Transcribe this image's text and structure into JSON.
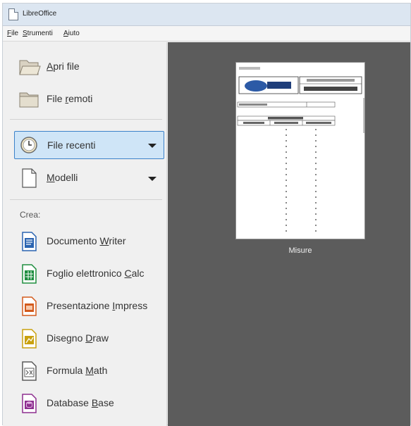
{
  "window": {
    "title": "LibreOffice"
  },
  "menu": {
    "file": {
      "mnemonic": "F",
      "rest": "ile"
    },
    "tools": {
      "mnemonic": "S",
      "rest": "trumenti"
    },
    "help": {
      "mnemonic": "A",
      "rest": "iuto"
    }
  },
  "sidebar": {
    "open_file": {
      "mnemonic": "A",
      "rest": "pri file"
    },
    "remote_files": {
      "before": "File ",
      "mnemonic": "r",
      "after": "emoti"
    },
    "recent_files": {
      "before": "File ",
      "mnemonic": "r",
      "after": "ecenti"
    },
    "templates": {
      "mnemonic": "M",
      "rest": "odelli"
    },
    "create_heading": "Crea:",
    "create_items": [
      {
        "before": "Documento ",
        "mnemonic": "W",
        "after": "riter",
        "icon": "writer-icon",
        "color": "#2a64b1"
      },
      {
        "before": "Foglio elettronico ",
        "mnemonic": "C",
        "after": "alc",
        "icon": "calc-icon",
        "color": "#1e8d3f"
      },
      {
        "before": "Presentazione ",
        "mnemonic": "I",
        "after": "mpress",
        "icon": "impress-icon",
        "color": "#d35a1c"
      },
      {
        "before": "Disegno ",
        "mnemonic": "D",
        "after": "raw",
        "icon": "draw-icon",
        "color": "#c9a10f"
      },
      {
        "before": "Formula ",
        "mnemonic": "M",
        "after": "ath",
        "icon": "math-icon",
        "color": "#5a5a5a"
      },
      {
        "before": "Database ",
        "mnemonic": "B",
        "after": "ase",
        "icon": "base-icon",
        "color": "#8d2f8f"
      }
    ]
  },
  "recent_documents": [
    {
      "name": "Misure"
    }
  ],
  "colors": {
    "accent": "#3c82c9",
    "selected_bg": "#cfe5f7",
    "preview_bg": "#5c5c5c"
  }
}
